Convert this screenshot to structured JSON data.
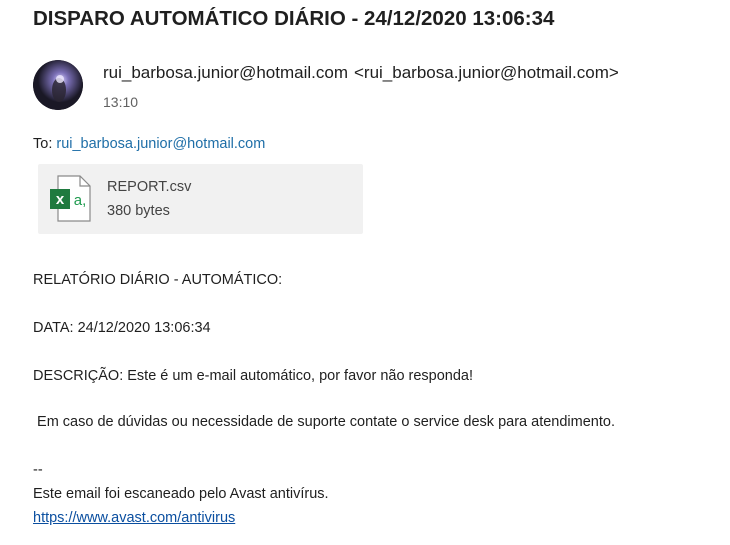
{
  "email": {
    "subject": "DISPARO AUTOMÁTICO DIÁRIO - 24/12/2020 13:06:34",
    "sender_name": "rui_barbosa.junior@hotmail.com",
    "sender_address": "<rui_barbosa.junior@hotmail.com>",
    "time": "13:10",
    "to_label": "To:",
    "to_address": "rui_barbosa.junior@hotmail.com",
    "attachment": {
      "name": "REPORT.csv",
      "size": "380 bytes",
      "icon": "excel-file-icon"
    },
    "body": {
      "heading": "RELATÓRIO DIÁRIO - AUTOMÁTICO:",
      "date_line": "DATA: 24/12/2020 13:06:34",
      "description": "DESCRIÇÃO: Este é um e-mail automático, por favor não responda!",
      "support": " Em caso de dúvidas ou necessidade de suporte contate o service desk para atendimento.",
      "signature_separator": "--",
      "signature_text": "Este email foi escaneado pelo Avast antivírus.",
      "signature_link": "https://www.avast.com/antivirus"
    }
  },
  "colors": {
    "link": "#1e6ea7",
    "attachment_bg": "#f1f1f1",
    "excel_green": "#1f7a3f"
  }
}
